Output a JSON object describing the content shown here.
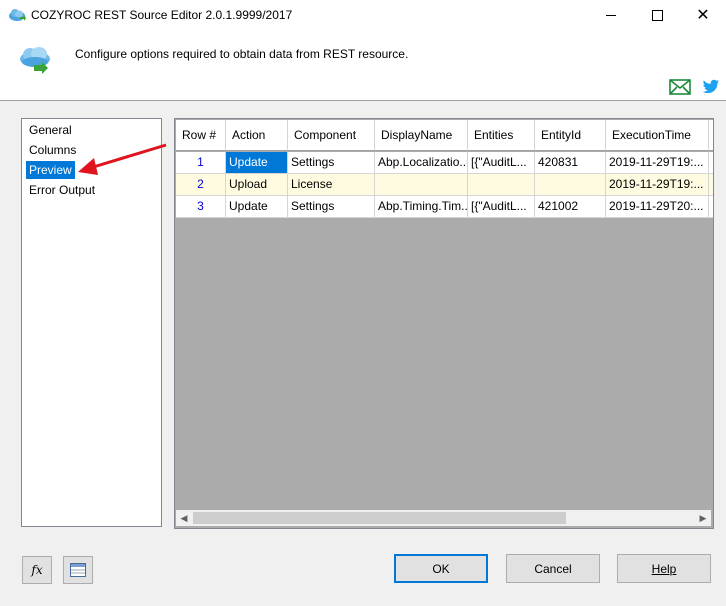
{
  "window": {
    "title": "COZYROC REST Source Editor 2.0.1.9999/2017",
    "close_glyph": "✕"
  },
  "header": {
    "description": "Configure options required to obtain data from REST resource."
  },
  "nav": {
    "items": [
      {
        "label": "General",
        "selected": false
      },
      {
        "label": "Columns",
        "selected": false
      },
      {
        "label": "Preview",
        "selected": true
      },
      {
        "label": "Error Output",
        "selected": false
      }
    ]
  },
  "grid": {
    "columns": [
      "Row #",
      "Action",
      "Component",
      "DisplayName",
      "Entities",
      "EntityId",
      "ExecutionTime"
    ],
    "rows": [
      {
        "row": "1",
        "action": "Update",
        "component": "Settings",
        "display_name": "Abp.Localizatio...",
        "entities": "[{\"AuditL...",
        "entity_id": "420831",
        "execution_time": "2019-11-29T19:..."
      },
      {
        "row": "2",
        "action": "Upload",
        "component": "License",
        "display_name": "",
        "entities": "",
        "entity_id": "",
        "execution_time": "2019-11-29T19:..."
      },
      {
        "row": "3",
        "action": "Update",
        "component": "Settings",
        "display_name": "Abp.Timing.Tim...",
        "entities": "[{\"AuditL...",
        "entity_id": "421002",
        "execution_time": "2019-11-29T20:..."
      }
    ],
    "selected_cell": {
      "row": 1,
      "column": "Action"
    }
  },
  "buttons": {
    "ok": "OK",
    "cancel": "Cancel",
    "help": "Help",
    "fx": "fx"
  },
  "colors": {
    "selection": "#0078d7",
    "alt_row": "#fffbe0",
    "arrow": "#e0141e",
    "mail_icon": "#1e8a3c",
    "twitter_icon": "#1da1f2"
  },
  "icons": {
    "app": "cloud-icon",
    "header": "cloud-download-icon",
    "mail": "mail-icon",
    "twitter": "twitter-icon",
    "expression": "fx-icon",
    "view": "grid-view-icon"
  }
}
